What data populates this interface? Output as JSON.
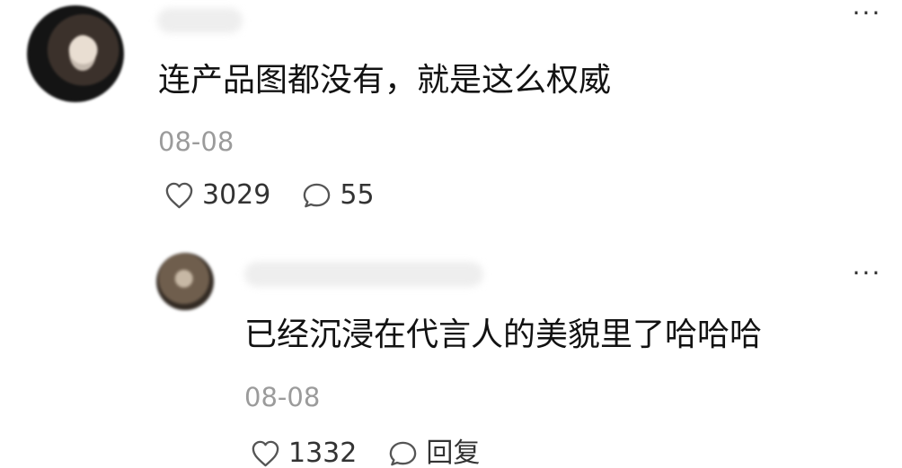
{
  "comments": [
    {
      "text": "连产品图都没有，就是这么权威",
      "date": "08-08",
      "likes": "3029",
      "reply_count": "55"
    },
    {
      "text": "已经沉浸在代言人的美貌里了哈哈哈",
      "date": "08-08",
      "likes": "1332",
      "reply_label": "回复"
    }
  ],
  "more_label": "···",
  "icons": {
    "like": "heart-outline-icon",
    "comment": "speech-bubble-icon"
  },
  "colors": {
    "text": "#121212",
    "secondary_text": "#9b9b9b",
    "icon": "#444444",
    "background": "#ffffff"
  }
}
